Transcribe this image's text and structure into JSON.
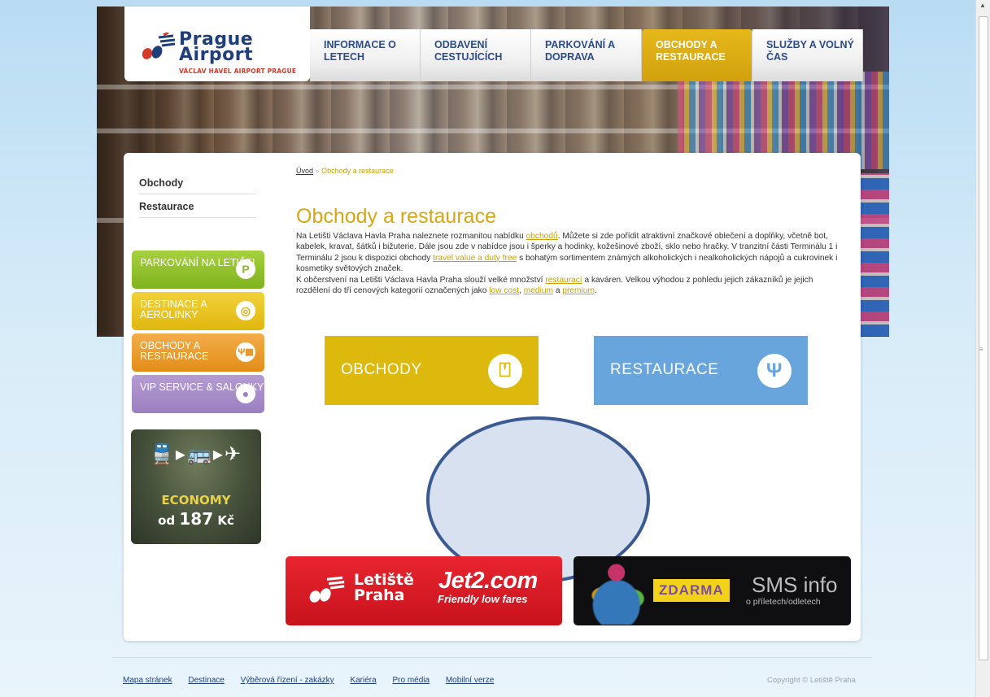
{
  "logo": {
    "title_line1": "Prague",
    "title_line2": "Airport",
    "subtitle": "VÁCLAV HAVEL AIRPORT PRAGUE"
  },
  "main_nav": [
    {
      "label": "INFORMACE O LETECH",
      "active": false
    },
    {
      "label": "ODBAVENÍ CESTUJÍCÍCH",
      "active": false
    },
    {
      "label": "PARKOVÁNÍ A DOPRAVA",
      "active": false
    },
    {
      "label": "OBCHODY A RESTAURACE",
      "active": true
    },
    {
      "label": "SLUŽBY A VOLNÝ ČAS",
      "active": false
    }
  ],
  "sidebar": {
    "items": [
      {
        "label": "Obchody"
      },
      {
        "label": "Restaurace"
      }
    ],
    "quick_links": [
      {
        "label": "PARKOVÁNÍ NA LETIŠTI",
        "icon": "parking-icon",
        "glyph": "P",
        "color": "#8bbd27"
      },
      {
        "label": "DESTINACE A AEROLINKY",
        "icon": "globe-icon",
        "glyph": "◎",
        "color": "#dfb70f"
      },
      {
        "label": "OBCHODY A RESTAURACE",
        "icon": "shop-restaurant-icon",
        "glyph": "Ψ▦",
        "color": "#e38d18"
      },
      {
        "label": "VIP SERVICE & SALONKY",
        "icon": "person-icon",
        "glyph": "●",
        "color": "#9a7fbf"
      }
    ],
    "economy_ad": {
      "label": "ECONOMY",
      "price_prefix": "od",
      "price": "187",
      "currency": "Kč"
    }
  },
  "breadcrumb": {
    "home": "Úvod",
    "separator": "»",
    "current": "Obchody a restaurace"
  },
  "page_title": "Obchody a restaurace",
  "intro": {
    "p1_a": "Na Letišti Václava Havla Praha naleznete rozmanitou nabídku ",
    "p1_link1": "obchodů",
    "p1_b": ". Můžete si zde pořídit atraktivní značkové oblečení a doplňky, včetně bot, kabelek, kravat, šátků i bižuterie. Dále jsou zde v nabídce jsou i šperky a hodinky, kožešinové zboží, sklo nebo hračky. V tranzitní části Terminálu 1 i Terminálu 2 jsou k dispozici obchody ",
    "p1_link2": "travel value a duty free",
    "p1_c": " s bohatým sortimentem známých alkoholických i nealkoholických nápojů a cukrovinek i kosmetiky světových značek.",
    "p2_a": "K občerstvení na Letišti Václava Havla Praha slouží velké množství ",
    "p2_link1": "restaurací",
    "p2_b": " a kaváren. Velkou výhodou z pohledu jejich zákazníků je jejich rozdělení  do tří cenových kategorií označených jako ",
    "p2_link2": "low cost",
    "p2_c": ", ",
    "p2_link3": "medium",
    "p2_d": " a ",
    "p2_link4": "premium",
    "p2_e": "."
  },
  "tiles": [
    {
      "label": "OBCHODY",
      "icon": "gift-icon",
      "color": "#deb90d"
    },
    {
      "label": "RESTAURACE",
      "icon": "cutlery-icon",
      "color": "#67a5dc"
    }
  ],
  "banners": {
    "jet2": {
      "brand_line1": "Letiště",
      "brand_line2": "Praha",
      "partner": "Jet2.com",
      "tagline": "Friendly low fares"
    },
    "sms": {
      "badge": "ZDARMA",
      "title": "SMS info",
      "subtitle": "o příletech/odletech"
    }
  },
  "footer": {
    "links": [
      "Mapa stránek",
      "Destinace",
      "Výběrová řízení - zakázky",
      "Kariéra",
      "Pro média",
      "Mobilní verze"
    ],
    "copyright": "Copyright © Letiště Praha"
  }
}
